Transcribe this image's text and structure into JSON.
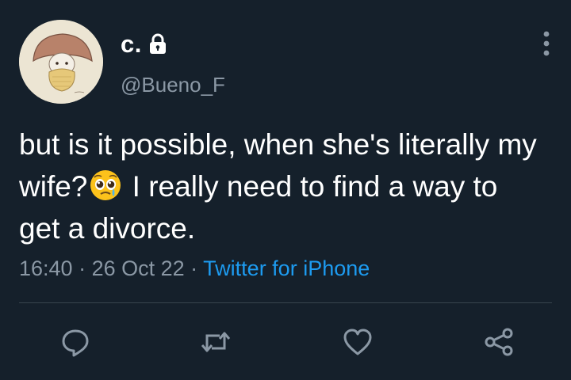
{
  "user": {
    "display_name": "c.",
    "handle": "@Bueno_F",
    "protected_icon": "lock-icon",
    "avatar_description_icon": "mushroom-character-avatar"
  },
  "tweet": {
    "text_before_emoji": "but is it possible, when she's literally my wife?",
    "emoji": "pleading-face-with-tear",
    "text_after_emoji": " I really need to find a way to get a divorce."
  },
  "meta": {
    "time": "16:40",
    "separator": " · ",
    "date": "26 Oct 22",
    "source": "Twitter for iPhone"
  },
  "actions": [
    "reply-icon",
    "retweet-icon",
    "like-icon",
    "share-icon"
  ],
  "colors": {
    "background": "#15202b",
    "text": "#ffffff",
    "secondary": "#8b98a5",
    "link": "#1d9bf0",
    "divider": "#38444d"
  }
}
